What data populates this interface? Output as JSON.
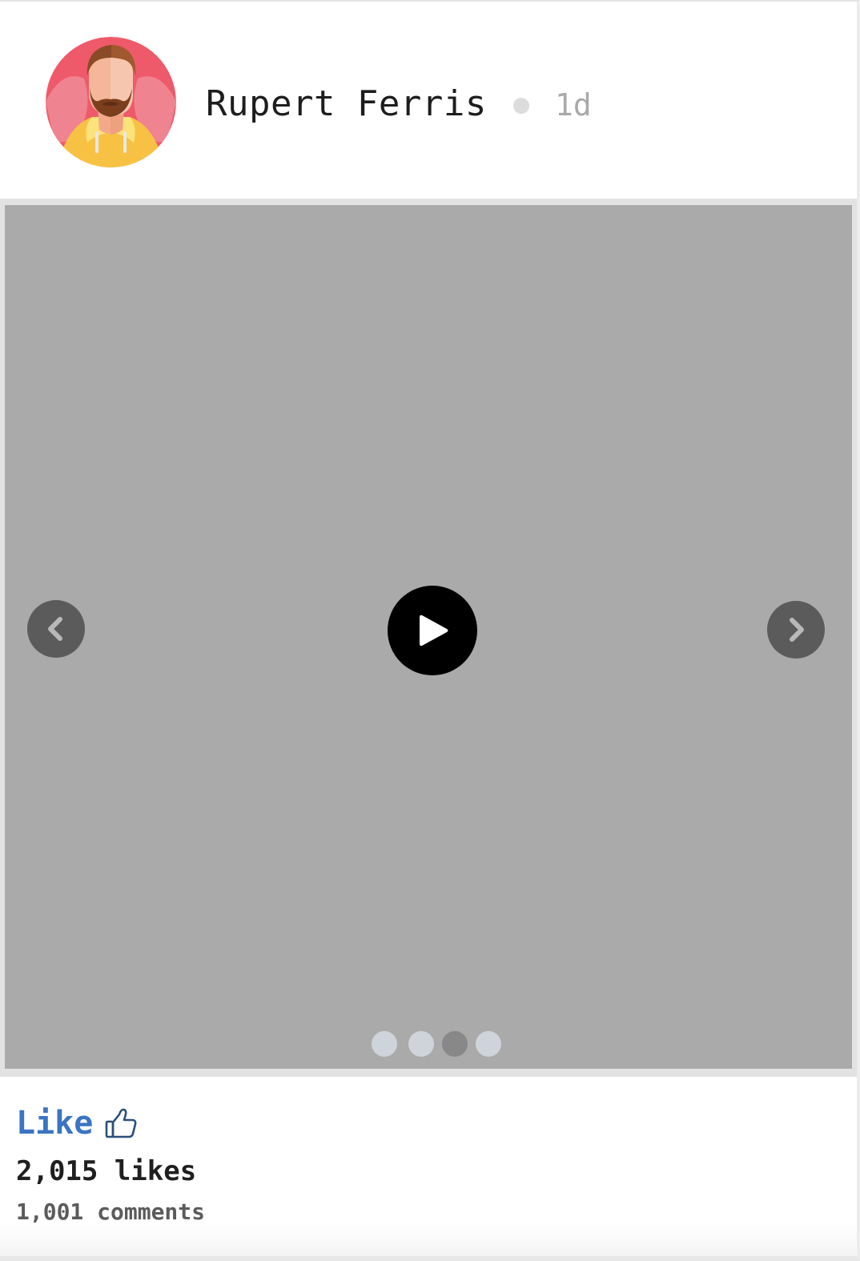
{
  "post": {
    "author": {
      "name": "Rupert Ferris",
      "avatar_icon": "bearded-man-avatar-icon"
    },
    "time": "1d"
  },
  "media": {
    "type": "video",
    "background_color": "#aaaaaa",
    "play_icon": "play-icon",
    "prev_icon": "chevron-left-icon",
    "next_icon": "chevron-right-icon",
    "slides": [
      {
        "active": false
      },
      {
        "active": false
      },
      {
        "active": true
      },
      {
        "active": false
      }
    ]
  },
  "actions": {
    "like_label": "Like",
    "like_icon": "thumbs-up-icon",
    "like_color": "#3b74c2"
  },
  "stats": {
    "likes": "2,015 likes",
    "comments": "1,001 comments"
  }
}
